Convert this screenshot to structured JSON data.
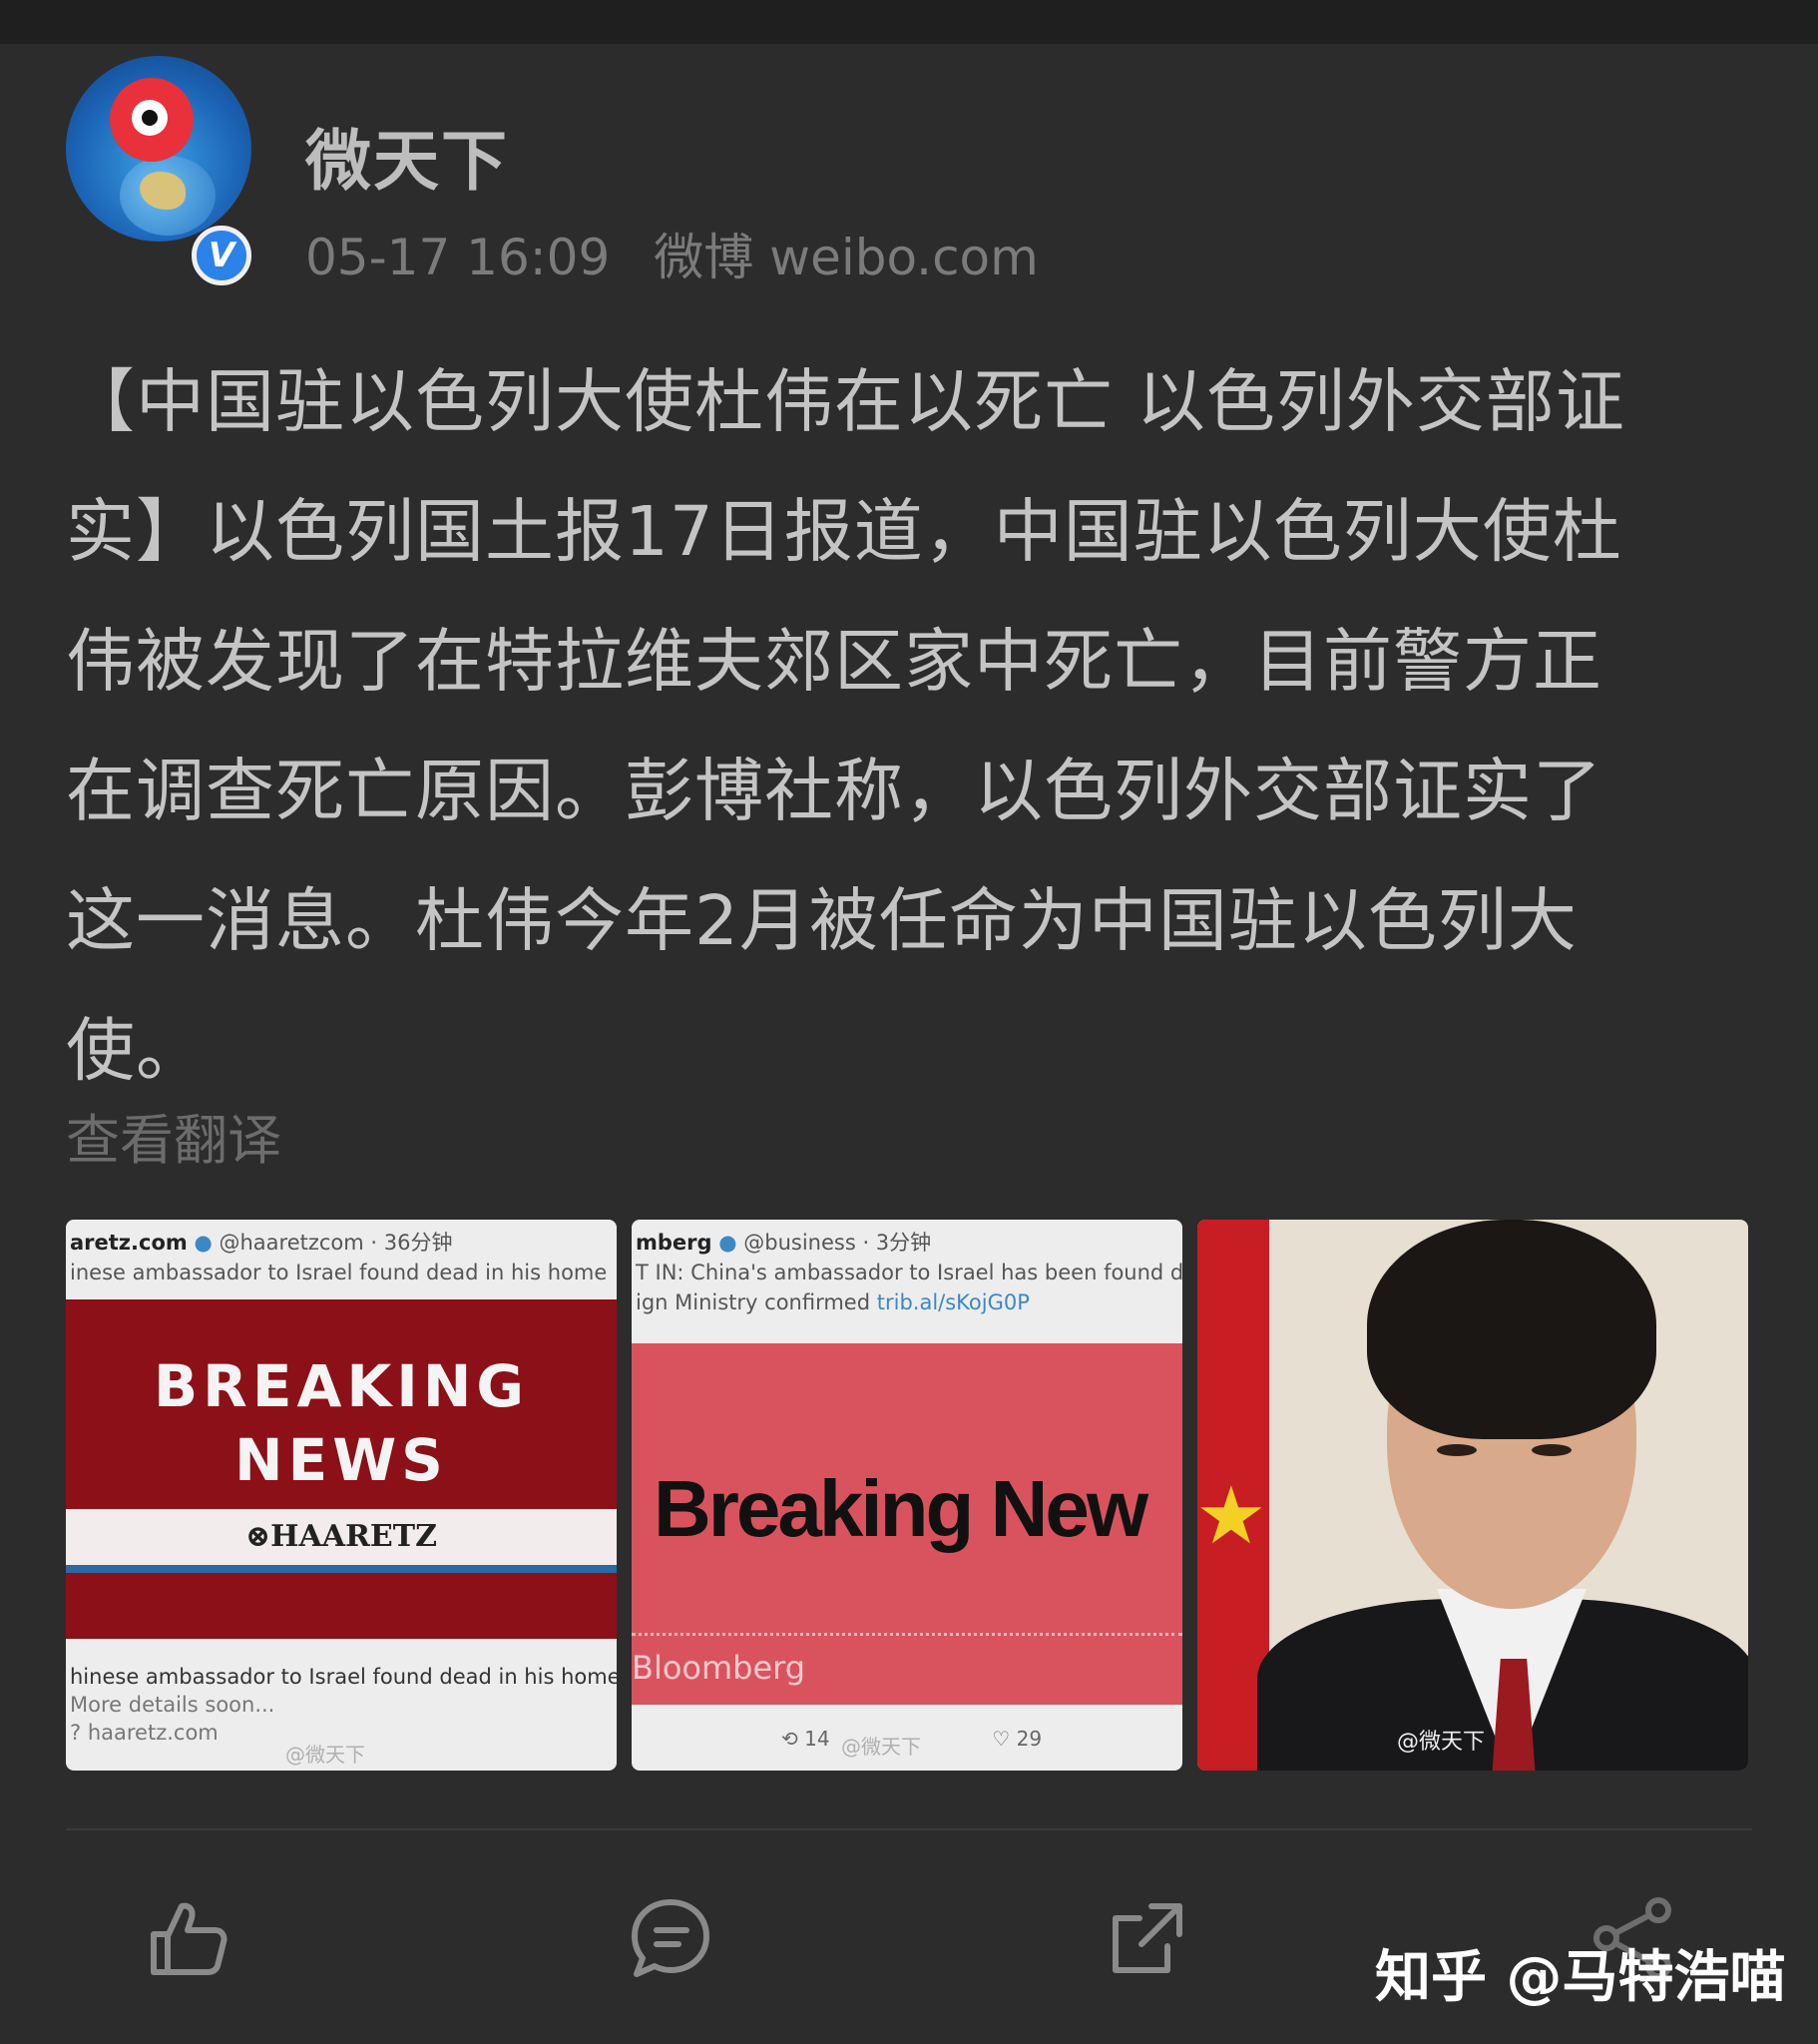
{
  "post": {
    "username": "微天下",
    "verified_badge": "V",
    "time": "05-17 16:09",
    "source": "微博 weibo.com",
    "content_lines": [
      "【中国驻以色列大使杜伟在以死亡 以色列外交部证",
      "实】以色列国土报17日报道，中国驻以色列大使杜",
      "伟被发现了在特拉维夫郊区家中死亡，目前警方正",
      "在调查死亡原因。彭博社称，以色列外交部证实了",
      "这一消息。杜伟今年2月被任命为中国驻以色列大",
      "使。"
    ],
    "translate_label": "查看翻译"
  },
  "images": {
    "haaretz": {
      "handle": "aretz.com",
      "handle_meta": "@haaretzcom · 36分钟",
      "tweet": "inese ambassador to Israel found dead in his home",
      "breaking": "BREAKING",
      "news": "NEWS",
      "logo": "⊗HAARETZ",
      "footer_title": "hinese ambassador to Israel found dead in his home",
      "footer_sub": "More details soon...",
      "footer_link": "haaretz.com",
      "watermark": "@微天下"
    },
    "bloomberg": {
      "handle": "mberg",
      "handle_meta": "@business · 3分钟",
      "tweet_line1": "T IN: China's ambassador to Israel has been found dea",
      "tweet_line2": "ign Ministry confirmed ",
      "tweet_link": "trib.al/sKojG0P",
      "headline": "Breaking New",
      "brand": "Bloomberg",
      "retweets": "14",
      "likes": "29",
      "watermark": "@微天下"
    },
    "portrait": {
      "watermark": "@微天下"
    }
  },
  "actions": {
    "like_icon": "thumbs-up-icon",
    "comment_icon": "comment-icon",
    "share_icon": "share-out-icon",
    "more_icon": "share-nodes-icon"
  },
  "overlay": {
    "zhihu_watermark": "知乎 @马特浩喵"
  },
  "colors": {
    "background": "#2c2c2c",
    "text": "#c4c4c4",
    "muted": "#7b7b7b",
    "verified": "#2b82e8"
  }
}
